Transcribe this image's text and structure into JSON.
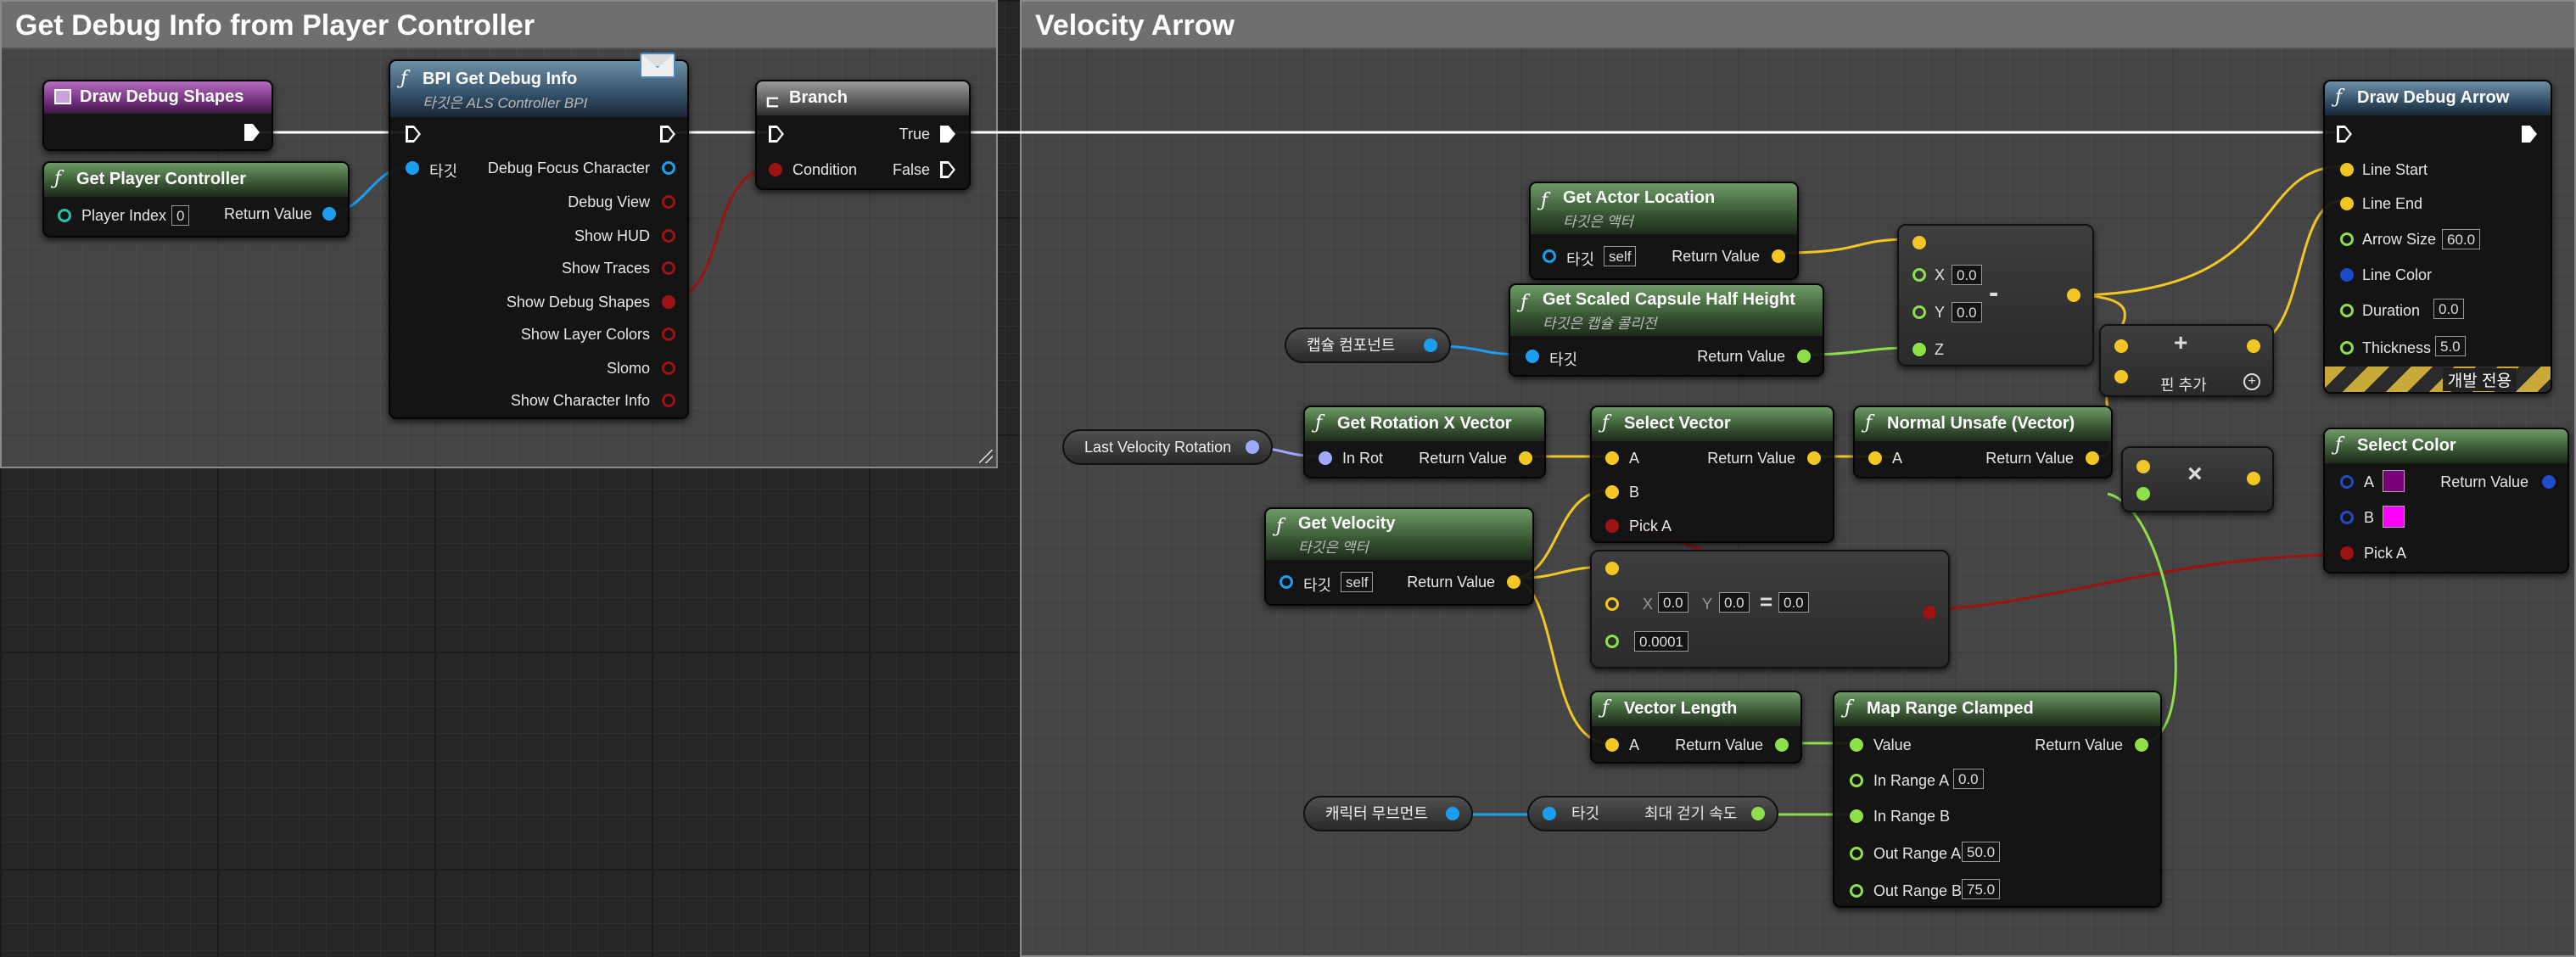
{
  "comments": {
    "left": {
      "title": "Get Debug Info from Player Controller"
    },
    "right": {
      "title": "Velocity Arrow"
    }
  },
  "colors": {
    "exec": "#ffffff",
    "object": "#1c9ef0",
    "bool": "#9c1313",
    "float": "#8ee04a",
    "vector": "#f2c624",
    "rotator": "#9fa9ff",
    "linear_color": "#1e4cc8",
    "int": "#20c6a6"
  },
  "nodes": {
    "draw_debug_shapes": {
      "title": "Draw Debug Shapes"
    },
    "get_player_controller": {
      "title": "Get Player Controller",
      "player_index_label": "Player Index",
      "player_index_value": "0",
      "return_label": "Return Value"
    },
    "bpi_get_debug_info": {
      "title": "BPI Get Debug Info",
      "subtitle": "타깃은 ALS Controller BPI",
      "target_label": "타깃",
      "outputs": [
        "Debug Focus Character",
        "Debug View",
        "Show HUD",
        "Show Traces",
        "Show Debug Shapes",
        "Show Layer Colors",
        "Slomo",
        "Show Character Info"
      ]
    },
    "branch": {
      "title": "Branch",
      "condition_label": "Condition",
      "true_label": "True",
      "false_label": "False"
    },
    "get_actor_location": {
      "title": "Get Actor Location",
      "subtitle": "타깃은 액터",
      "target_label": "타깃",
      "target_value": "self",
      "return_label": "Return Value"
    },
    "get_scaled_capsule": {
      "title": "Get Scaled Capsule Half Height",
      "subtitle": "타깃은 캡슐 콜리전",
      "target_label": "타깃",
      "return_label": "Return Value"
    },
    "capsule_var": {
      "label": "캡슐 컴포넌트"
    },
    "make_vector": {
      "x_label": "X",
      "x_value": "0.0",
      "y_label": "Y",
      "y_value": "0.0",
      "z_label": "Z",
      "op": "-"
    },
    "add_node": {
      "add_pin_label": "핀 추가",
      "op": "+"
    },
    "draw_debug_arrow": {
      "title": "Draw Debug Arrow",
      "inputs": {
        "line_start": "Line Start",
        "line_end": "Line End",
        "arrow_size": "Arrow Size",
        "arrow_size_value": "60.0",
        "line_color": "Line Color",
        "duration": "Duration",
        "duration_value": "0.0",
        "thickness": "Thickness",
        "thickness_value": "5.0"
      },
      "dev_only": "개발 전용"
    },
    "last_velocity_rotation": {
      "label": "Last Velocity Rotation"
    },
    "get_rotation_x_vector": {
      "title": "Get Rotation X Vector",
      "in_label": "In Rot",
      "return_label": "Return Value"
    },
    "select_vector": {
      "title": "Select Vector",
      "a_label": "A",
      "b_label": "B",
      "pick_label": "Pick A",
      "return_label": "Return Value"
    },
    "normal_unsafe": {
      "title": "Normal Unsafe (Vector)",
      "a_label": "A",
      "return_label": "Return Value"
    },
    "multiply": {
      "op": "×"
    },
    "select_color": {
      "title": "Select Color",
      "a_label": "A",
      "b_label": "B",
      "pick_label": "Pick A",
      "return_label": "Return Value",
      "color_a": "#7a007a",
      "color_b": "#ff00ff"
    },
    "get_velocity": {
      "title": "Get Velocity",
      "subtitle": "타깃은 액터",
      "target_label": "타깃",
      "target_value": "self",
      "return_label": "Return Value"
    },
    "vector_compare": {
      "x_label": "X",
      "x_value": "0.0",
      "y_label": "Y",
      "y_value": "0.0",
      "z_value": "0.0",
      "tolerance": "0.0001"
    },
    "vector_length": {
      "title": "Vector Length",
      "a_label": "A",
      "return_label": "Return Value"
    },
    "map_range_clamped": {
      "title": "Map Range Clamped",
      "value_label": "Value",
      "in_range_a": "In Range A",
      "in_range_a_value": "0.0",
      "in_range_b": "In Range B",
      "out_range_a": "Out Range A",
      "out_range_a_value": "50.0",
      "out_range_b": "Out Range B",
      "out_range_b_value": "75.0",
      "return_label": "Return Value"
    },
    "character_movement_var": {
      "label": "캐릭터 무브먼트"
    },
    "max_walk_speed": {
      "target_label": "타깃",
      "out_label": "최대 걷기 속도"
    }
  }
}
